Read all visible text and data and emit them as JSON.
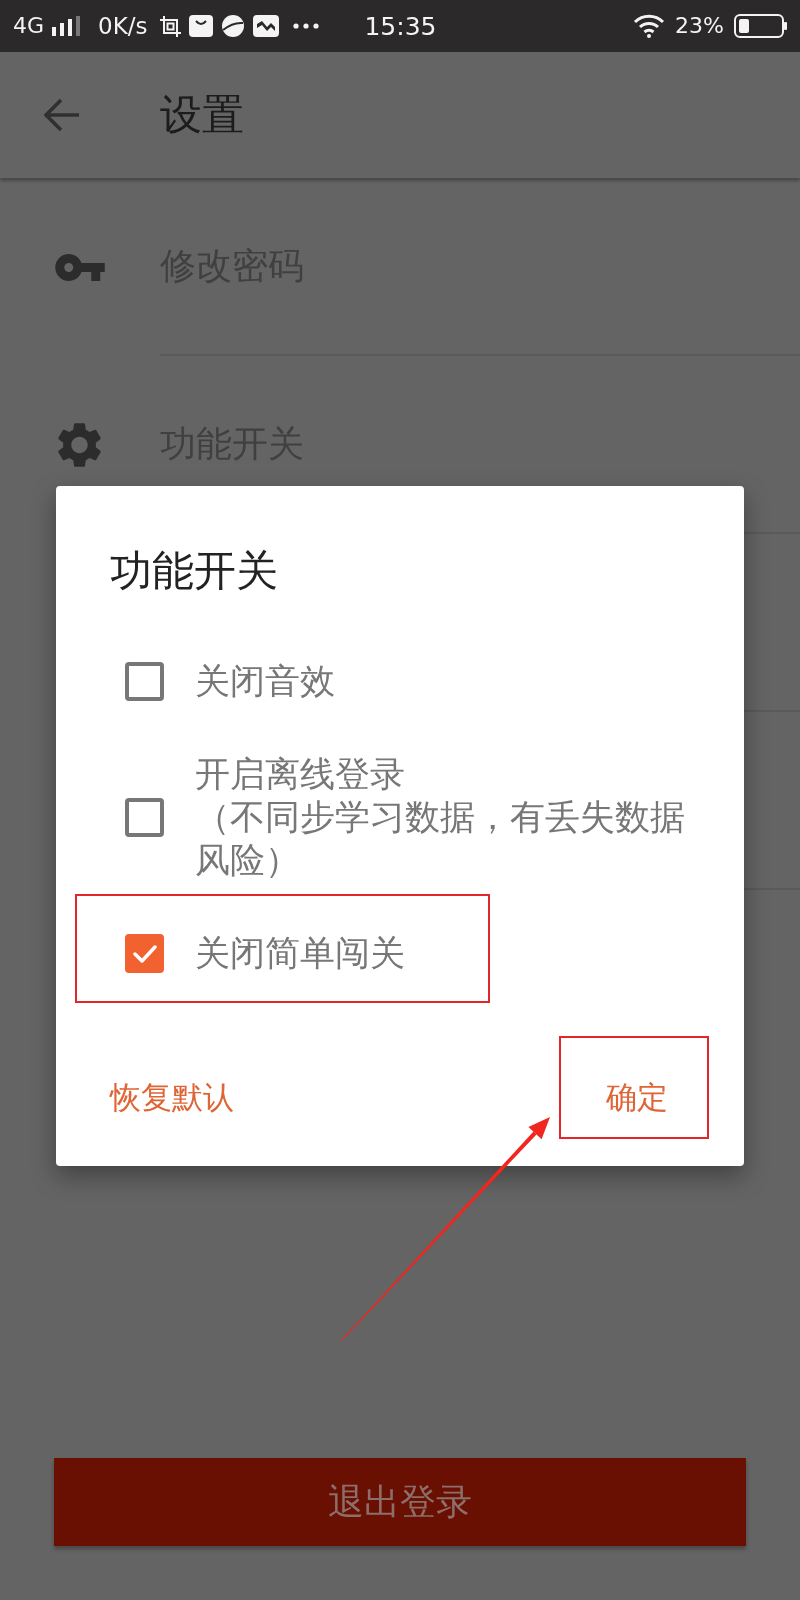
{
  "status_bar": {
    "network": "4G",
    "speed": "0K/s",
    "time": "15:35",
    "battery": "23%"
  },
  "app_bar": {
    "title": "设置"
  },
  "settings": [
    {
      "label": "修改密码"
    },
    {
      "label": "功能开关"
    }
  ],
  "dialog": {
    "title": "功能开关",
    "options": [
      {
        "label": "关闭音效",
        "checked": false,
        "highlighted": false
      },
      {
        "label": "开启离线登录",
        "note": "（不同步学习数据，有丢失数据风险）",
        "checked": false,
        "highlighted": false
      },
      {
        "label": "关闭简单闯关",
        "checked": true,
        "highlighted": true
      }
    ],
    "buttons": [
      {
        "label": "恢复默认",
        "highlighted": false
      },
      {
        "label": "确定",
        "highlighted": true
      }
    ],
    "pointer_arrow": true
  },
  "logout_button": {
    "label": "退出登录"
  }
}
